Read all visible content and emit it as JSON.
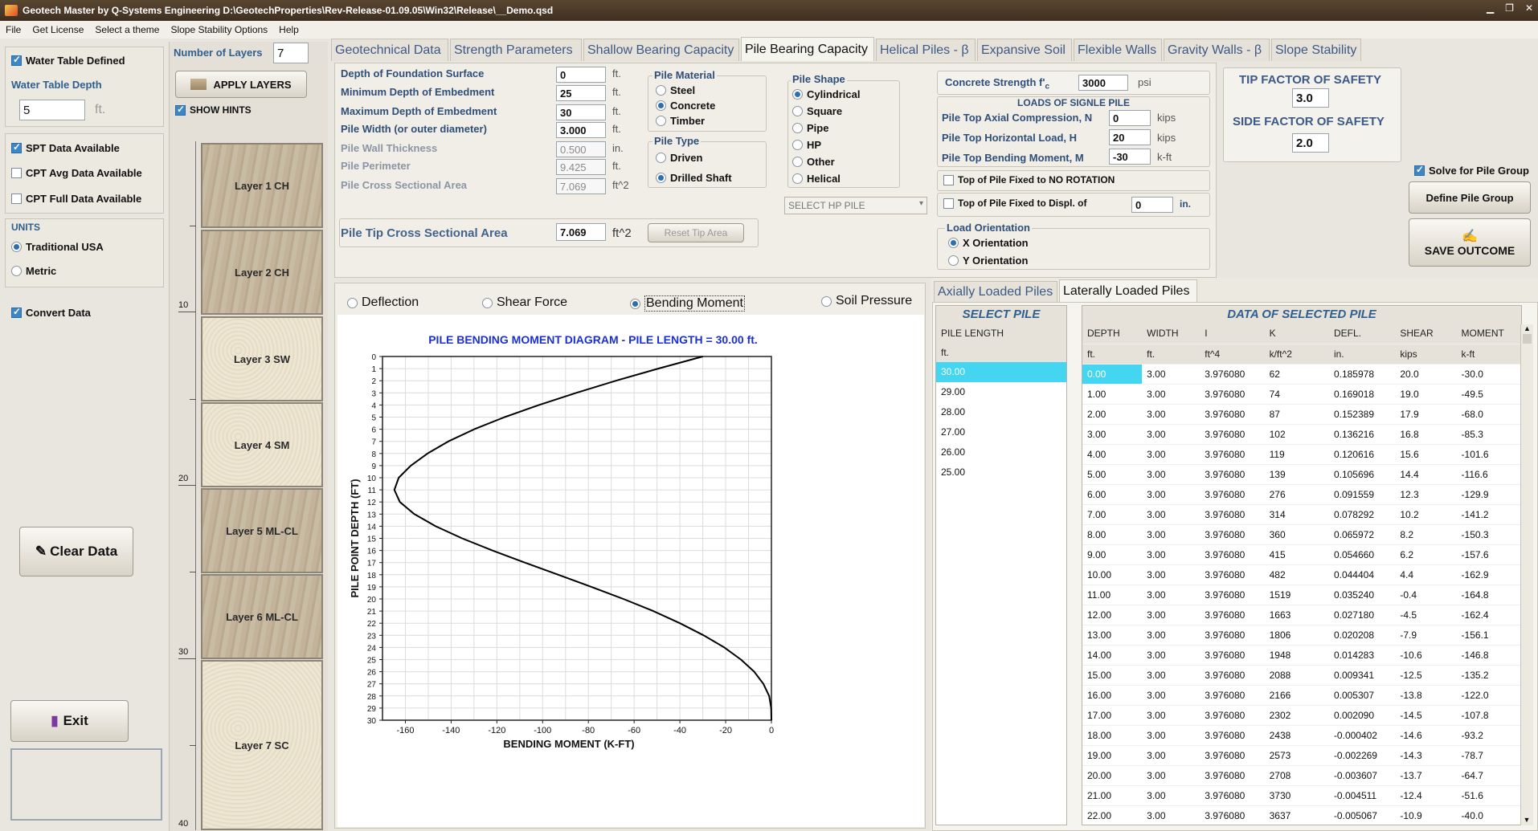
{
  "window": {
    "title": "Geotech Master by Q-Systems Engineering   D:\\GeotechProperties\\Rev-Release-01.09.05\\Win32\\Release\\__Demo.qsd"
  },
  "menu": [
    "File",
    "Get License",
    "Select a theme",
    "Slope Stability Options",
    "Help"
  ],
  "left": {
    "water_table_defined": "Water Table Defined",
    "water_table_depth_label": "Water Table Depth",
    "water_table_depth": "5",
    "ft": "ft.",
    "spt": "SPT Data Available",
    "cpt_avg": "CPT Avg Data Available",
    "cpt_full": "CPT Full Data Available",
    "units_label": "UNITS",
    "units_trad": "Traditional USA",
    "units_metric": "Metric",
    "convert": "Convert Data",
    "clear": "Clear Data",
    "exit": "Exit"
  },
  "layers": {
    "num_label": "Number of Layers",
    "num": "7",
    "apply": "APPLY LAYERS",
    "show_hints": "SHOW HINTS",
    "depth_ticks": [
      "10",
      "20",
      "30",
      "40"
    ],
    "items": [
      "Layer 1 CH",
      "Layer 2 CH",
      "Layer 3 SW",
      "Layer 4 SM",
      "Layer 5 ML-CL",
      "Layer 6 ML-CL",
      "Layer 7 SC"
    ]
  },
  "tabs": [
    "Geotechnical Data",
    "Strength Parameters",
    "Shallow Bearing Capacity",
    "Pile Bearing Capacity",
    "Helical Piles - β",
    "Expansive Soil",
    "Flexible Walls",
    "Gravity Walls - β",
    "Slope Stability"
  ],
  "pile": {
    "depth_found": {
      "label": "Depth of Foundation Surface",
      "value": "0",
      "unit": "ft."
    },
    "min_depth": {
      "label": "Minimum Depth of Embedment",
      "value": "25",
      "unit": "ft."
    },
    "max_depth": {
      "label": "Maximum Depth of Embedment",
      "value": "30",
      "unit": "ft."
    },
    "width": {
      "label": "Pile Width (or outer diameter)",
      "value": "3.000",
      "unit": "ft."
    },
    "wall": {
      "label": "Pile Wall Thickness",
      "value": "0.500",
      "unit": "in."
    },
    "perim": {
      "label": "Pile Perimeter",
      "value": "9.425",
      "unit": "ft."
    },
    "area": {
      "label": "Pile Cross Sectional Area",
      "value": "7.069",
      "unit": "ft^2"
    },
    "tip_area": {
      "label": "Pile Tip Cross Sectional Area",
      "value": "7.069",
      "unit": "ft^2",
      "reset": "Reset Tip Area"
    },
    "material": {
      "label": "Pile Material",
      "steel": "Steel",
      "concrete": "Concrete",
      "timber": "Timber"
    },
    "type": {
      "label": "Pile Type",
      "driven": "Driven",
      "drilled": "Drilled Shaft"
    },
    "shape": {
      "label": "Pile Shape",
      "cyl": "Cylindrical",
      "square": "Square",
      "pipe": "Pipe",
      "hp": "HP",
      "other": "Other",
      "helical": "Helical"
    },
    "hp_select": "SELECT HP PILE",
    "concrete": {
      "label": "Concrete Strength  f'",
      "sub": "c",
      "value": "3000",
      "unit": "psi"
    },
    "loads": {
      "title": "LOADS OF SIGNLE PILE",
      "axial": "Pile Top Axial Compression, N",
      "axial_v": "0",
      "axial_u": "kips",
      "horiz": "Pile Top Horizontal Load, H",
      "horiz_v": "20",
      "horiz_u": "kips",
      "moment": "Pile Top Bending Moment, M",
      "moment_v": "-30",
      "moment_u": "k-ft"
    },
    "fixed_rot": "Top of Pile Fixed to NO ROTATION",
    "fixed_disp": "Top of Pile Fixed to Displ.  of",
    "fixed_disp_v": "0",
    "fixed_disp_u": "in.",
    "orient": {
      "label": "Load Orientation",
      "x": "X Orientation",
      "y": "Y Orientation"
    },
    "fs": {
      "tip_label": "TIP FACTOR OF SAFETY",
      "tip": "3.0",
      "side_label": "SIDE FACTOR OF SAFETY",
      "side": "2.0"
    },
    "solve_group": "Solve for Pile Group",
    "define_group": "Define Pile Group",
    "save": "SAVE OUTCOME"
  },
  "plot": {
    "options": [
      "Deflection",
      "Shear Force",
      "Bending Moment",
      "Soil Pressure"
    ],
    "selected": "Bending Moment"
  },
  "chart_data": {
    "type": "line",
    "title": "PILE BENDING MOMENT DIAGRAM  -  PILE LENGTH = 30.00 ft.",
    "xlabel": "BENDING MOMENT (K-FT)",
    "ylabel": "PILE POINT DEPTH (FT)",
    "xlim": [
      -170,
      0
    ],
    "ylim": [
      30,
      0
    ],
    "xticks": [
      -160,
      -140,
      -120,
      -100,
      -80,
      -60,
      -40,
      -20,
      0
    ],
    "yticks": [
      0,
      1,
      2,
      3,
      4,
      5,
      6,
      7,
      8,
      9,
      10,
      11,
      12,
      13,
      14,
      15,
      16,
      17,
      18,
      19,
      20,
      21,
      22,
      23,
      24,
      25,
      26,
      27,
      28,
      29,
      30
    ],
    "grid": true,
    "x": [
      -30.0,
      -49.5,
      -68.0,
      -85.3,
      -101.6,
      -116.6,
      -129.9,
      -141.2,
      -150.3,
      -157.6,
      -162.9,
      -164.8,
      -162.4,
      -156.1,
      -146.8,
      -135.2,
      -122.0,
      -107.8,
      -93.2,
      -78.7,
      -64.7,
      -51.6,
      -40.0,
      -29.6,
      -20.6,
      -13.3,
      -7.5,
      -3.5,
      -1.0,
      -0.1,
      0
    ],
    "y": [
      0,
      1,
      2,
      3,
      4,
      5,
      6,
      7,
      8,
      9,
      10,
      11,
      12,
      13,
      14,
      15,
      16,
      17,
      18,
      19,
      20,
      21,
      22,
      23,
      24,
      25,
      26,
      27,
      28,
      29,
      30
    ]
  },
  "side_tabs": [
    "Axially Loaded Piles",
    "Laterally Loaded Piles"
  ],
  "select_pile": {
    "title": "SELECT PILE",
    "header": "PILE LENGTH",
    "unit": "ft.",
    "items": [
      "30.00",
      "29.00",
      "28.00",
      "27.00",
      "26.00",
      "25.00"
    ]
  },
  "selected_data": {
    "title": "DATA OF SELECTED PILE",
    "headers": [
      "DEPTH",
      "WIDTH",
      "I",
      "K",
      "DEFL.",
      "SHEAR",
      "MOMENT"
    ],
    "units": [
      "ft.",
      "ft.",
      "ft^4",
      "k/ft^2",
      "in.",
      "kips",
      "k-ft"
    ],
    "rows": [
      [
        "0.00",
        "3.00",
        "3.976080",
        "62",
        "0.185978",
        "20.0",
        "-30.0"
      ],
      [
        "1.00",
        "3.00",
        "3.976080",
        "74",
        "0.169018",
        "19.0",
        "-49.5"
      ],
      [
        "2.00",
        "3.00",
        "3.976080",
        "87",
        "0.152389",
        "17.9",
        "-68.0"
      ],
      [
        "3.00",
        "3.00",
        "3.976080",
        "102",
        "0.136216",
        "16.8",
        "-85.3"
      ],
      [
        "4.00",
        "3.00",
        "3.976080",
        "119",
        "0.120616",
        "15.6",
        "-101.6"
      ],
      [
        "5.00",
        "3.00",
        "3.976080",
        "139",
        "0.105696",
        "14.4",
        "-116.6"
      ],
      [
        "6.00",
        "3.00",
        "3.976080",
        "276",
        "0.091559",
        "12.3",
        "-129.9"
      ],
      [
        "7.00",
        "3.00",
        "3.976080",
        "314",
        "0.078292",
        "10.2",
        "-141.2"
      ],
      [
        "8.00",
        "3.00",
        "3.976080",
        "360",
        "0.065972",
        "8.2",
        "-150.3"
      ],
      [
        "9.00",
        "3.00",
        "3.976080",
        "415",
        "0.054660",
        "6.2",
        "-157.6"
      ],
      [
        "10.00",
        "3.00",
        "3.976080",
        "482",
        "0.044404",
        "4.4",
        "-162.9"
      ],
      [
        "11.00",
        "3.00",
        "3.976080",
        "1519",
        "0.035240",
        "-0.4",
        "-164.8"
      ],
      [
        "12.00",
        "3.00",
        "3.976080",
        "1663",
        "0.027180",
        "-4.5",
        "-162.4"
      ],
      [
        "13.00",
        "3.00",
        "3.976080",
        "1806",
        "0.020208",
        "-7.9",
        "-156.1"
      ],
      [
        "14.00",
        "3.00",
        "3.976080",
        "1948",
        "0.014283",
        "-10.6",
        "-146.8"
      ],
      [
        "15.00",
        "3.00",
        "3.976080",
        "2088",
        "0.009341",
        "-12.5",
        "-135.2"
      ],
      [
        "16.00",
        "3.00",
        "3.976080",
        "2166",
        "0.005307",
        "-13.8",
        "-122.0"
      ],
      [
        "17.00",
        "3.00",
        "3.976080",
        "2302",
        "0.002090",
        "-14.5",
        "-107.8"
      ],
      [
        "18.00",
        "3.00",
        "3.976080",
        "2438",
        "-0.000402",
        "-14.6",
        "-93.2"
      ],
      [
        "19.00",
        "3.00",
        "3.976080",
        "2573",
        "-0.002269",
        "-14.3",
        "-78.7"
      ],
      [
        "20.00",
        "3.00",
        "3.976080",
        "2708",
        "-0.003607",
        "-13.7",
        "-64.7"
      ],
      [
        "21.00",
        "3.00",
        "3.976080",
        "3730",
        "-0.004511",
        "-12.4",
        "-51.6"
      ],
      [
        "22.00",
        "3.00",
        "3.976080",
        "3637",
        "-0.005067",
        "-10.9",
        "-40.0"
      ]
    ]
  }
}
